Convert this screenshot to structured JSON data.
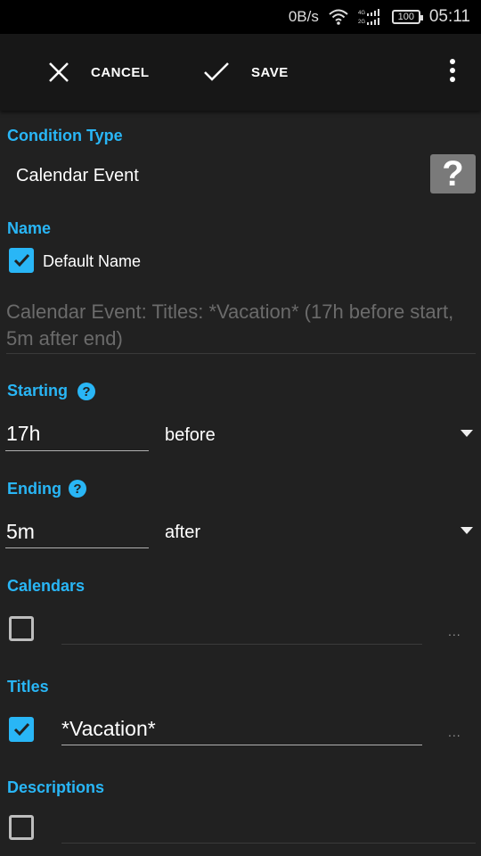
{
  "status": {
    "speed": "0B/s",
    "battery": "100",
    "time": "05:11"
  },
  "toolbar": {
    "cancel_label": "CANCEL",
    "save_label": "SAVE"
  },
  "condition": {
    "title": "Condition Type",
    "value": "Calendar Event",
    "help": "?"
  },
  "name": {
    "title": "Name",
    "default_label": "Default Name",
    "default_checked": true,
    "generated": "Calendar Event: Titles: *Vacation* (17h before start, 5m after end)"
  },
  "starting": {
    "title": "Starting",
    "value": "17h",
    "relation": "before",
    "info": "?"
  },
  "ending": {
    "title": "Ending",
    "value": "5m",
    "relation": "after",
    "info": "?"
  },
  "calendars": {
    "title": "Calendars",
    "checked": false,
    "value": "",
    "more": "..."
  },
  "titles": {
    "title": "Titles",
    "checked": true,
    "value": "*Vacation*",
    "more": "..."
  },
  "descriptions": {
    "title": "Descriptions",
    "checked": false,
    "value": ""
  },
  "colors": {
    "accent": "#29b6f6",
    "background": "#212121",
    "toolbar": "#171717"
  }
}
